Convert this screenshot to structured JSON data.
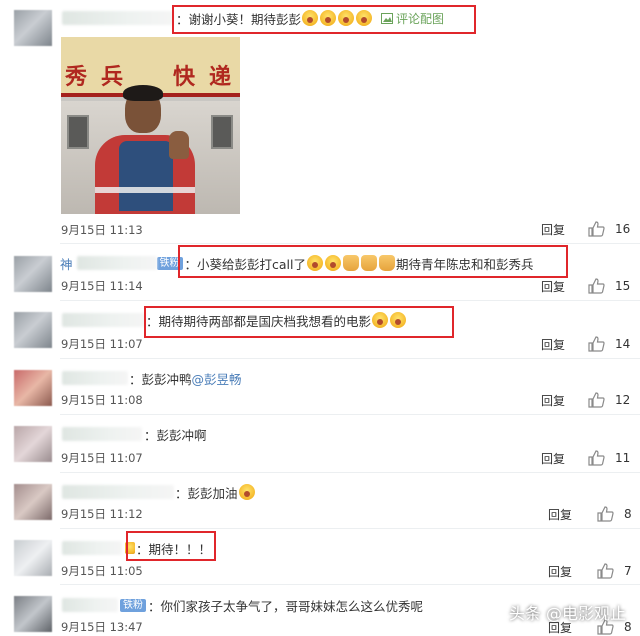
{
  "accent_color": "#e0262b",
  "comments": [
    {
      "name_visible": "",
      "text_parts": [
        {
          "t": "：谢谢小葵！期待彭彭"
        }
      ],
      "emoji": [
        "scream",
        "scream",
        "scream",
        "scream"
      ],
      "extra": "评论配图",
      "extra_icon": "image-icon",
      "time": "9月15日 11:13",
      "reply": "回复",
      "likes": "16",
      "has_photo": true
    },
    {
      "name_visible": "神",
      "badge": "铁粉",
      "text_parts": [
        {
          "t": "：小葵给彭彭打call了"
        }
      ],
      "emoji": [
        "scream",
        "scream",
        "thumb",
        "thumb",
        "thumb"
      ],
      "tail": "期待青年陈忠和和彭秀兵",
      "time": "9月15日 11:14",
      "reply": "回复",
      "likes": "15"
    },
    {
      "name_visible": "",
      "text_parts": [
        {
          "t": "：期待期待两部都是国庆档我想看的电影"
        }
      ],
      "emoji": [
        "scream",
        "scream"
      ],
      "time": "9月15日 11:07",
      "reply": "回复",
      "likes": "14"
    },
    {
      "name_visible": "",
      "text_parts": [
        {
          "t": "：彭彭冲鸭"
        }
      ],
      "mention": "@彭昱畅",
      "time": "9月15日 11:08",
      "reply": "回复",
      "likes": "12"
    },
    {
      "name_visible": "",
      "text_parts": [
        {
          "t": "：彭彭冲啊"
        }
      ],
      "time": "9月15日 11:07",
      "reply": "回复",
      "likes": "11"
    },
    {
      "name_visible": "",
      "text_parts": [
        {
          "t": "：彭彭加油"
        }
      ],
      "emoji": [
        "scream"
      ],
      "time": "9月15日 11:12",
      "reply": "回复",
      "likes": "8"
    },
    {
      "name_visible": "",
      "text_parts": [
        {
          "t": "：期待！！！"
        }
      ],
      "time": "9月15日 11:05",
      "reply": "回复",
      "likes": "7"
    },
    {
      "name_visible": "",
      "badge": "铁粉",
      "text_parts": [
        {
          "t": "：你们家孩子太争气了，哥哥妹妹怎么这么优秀呢"
        }
      ],
      "time": "9月15日 13:47",
      "reply": "回复",
      "likes": "8"
    }
  ],
  "photo": {
    "sign_chars": [
      "秀",
      "兵",
      "快",
      "递"
    ]
  },
  "watermark": "头条 @电影观止"
}
